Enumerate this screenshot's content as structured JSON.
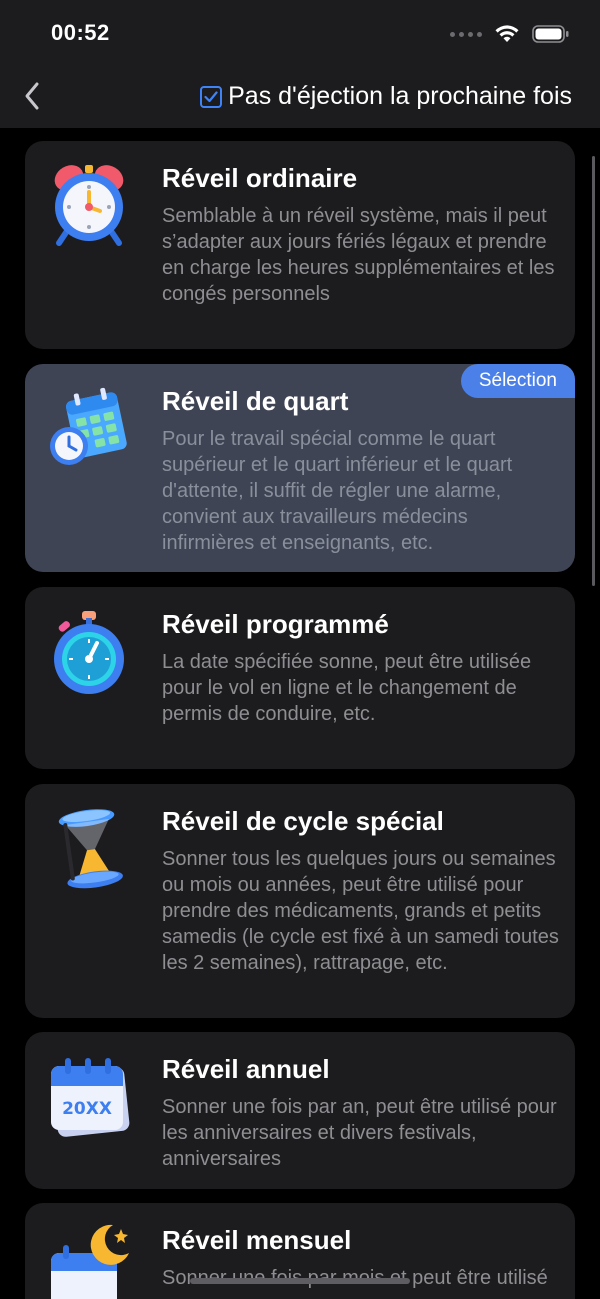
{
  "status_bar": {
    "time": "00:52"
  },
  "nav": {
    "back_icon": "chevron-left-icon",
    "eject_label": "Pas d'éjection la prochaine fois",
    "eject_checked": true
  },
  "colors": {
    "accent": "#3f83f8",
    "badge": "#4a80e8",
    "card": "#1c1c1e",
    "card_selected": "#3f4454"
  },
  "alarm_types": [
    {
      "title": "Réveil ordinaire",
      "description": "Semblable à un réveil système, mais il peut s’adapter aux jours fériés légaux et prendre en charge les heures supplémentaires et les congés personnels",
      "icon": "alarm-clock-icon",
      "selected": false
    },
    {
      "title": "Réveil de quart",
      "description": "Pour le travail spécial comme le quart supérieur et le quart inférieur et le quart d'attente, il suffit de régler une alarme, convient aux travailleurs médecins infirmières et enseignants, etc.",
      "icon": "shift-calendar-clock-icon",
      "selected": true,
      "badge": "Sélection"
    },
    {
      "title": "Réveil programmé",
      "description": "La date spécifiée sonne, peut être utilisée pour le vol en ligne et le changement de permis de conduire, etc.",
      "icon": "stopwatch-icon",
      "selected": false
    },
    {
      "title": "Réveil de cycle spécial",
      "description": "Sonner tous les quelques jours ou semaines ou mois ou années, peut être utilisé pour prendre des médicaments, grands et petits samedis (le cycle est fixé à un samedi toutes les 2 semaines), rattrapage, etc.",
      "icon": "hourglass-icon",
      "selected": false
    },
    {
      "title": "Réveil annuel",
      "description": "Sonner une fois par an, peut être utilisé pour les anniversaires et divers festivals, anniversaires",
      "icon": "calendar-20xx-icon",
      "icon_text": "20XX",
      "selected": false
    },
    {
      "title": "Réveil mensuel",
      "description": "Sonner une fois par mois et peut être utilisé pour ...",
      "icon": "calendar-moon-icon",
      "selected": false
    }
  ]
}
